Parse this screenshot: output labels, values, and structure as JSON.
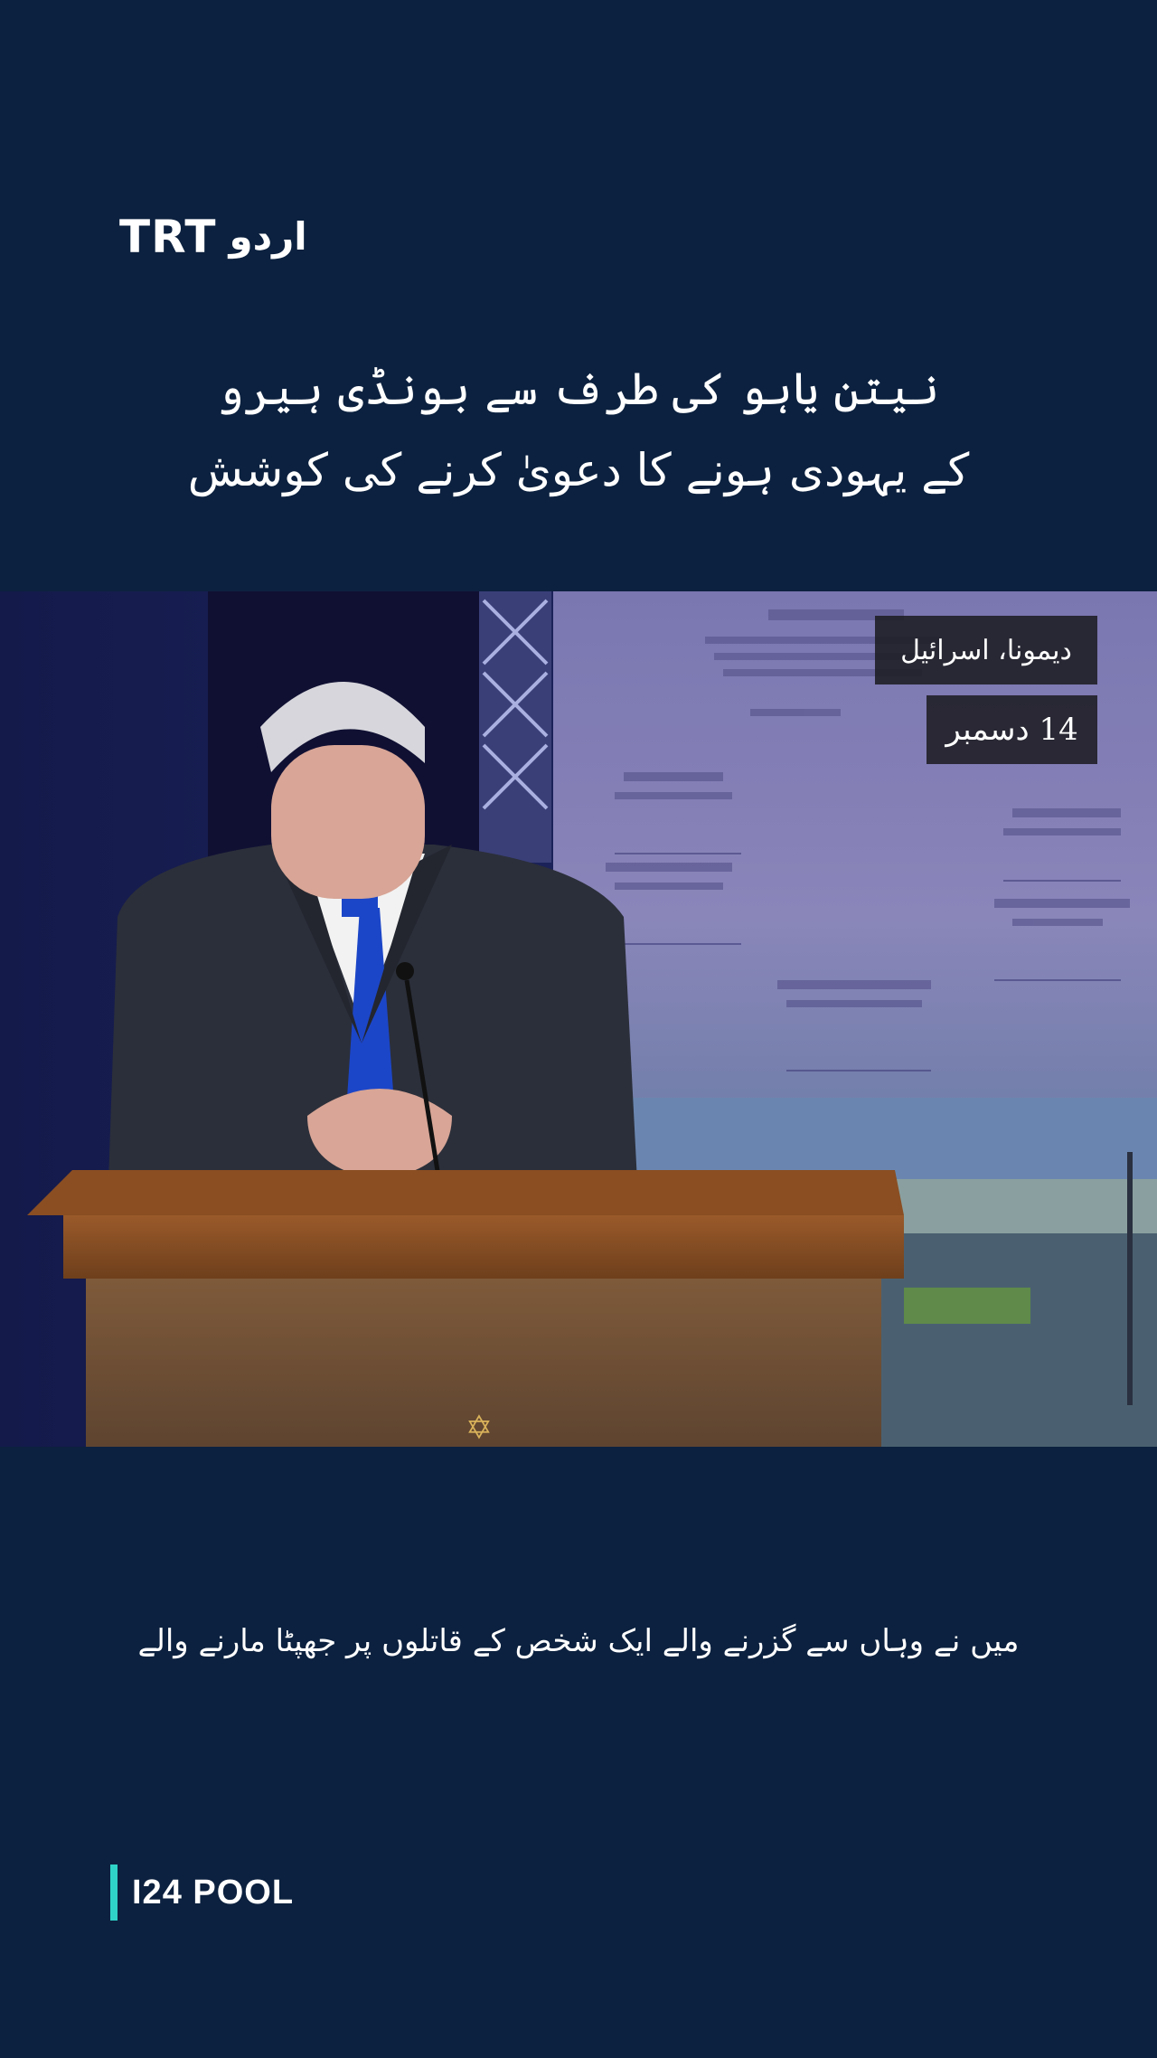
{
  "brand": {
    "latin": "TRT",
    "urdu": "اردو"
  },
  "headline": {
    "line1": "نیتن یاہو کی طرف سے بونڈی ہیرو",
    "line2": "کے یہودی ہونے کا دعویٰ کرنے کی کوشش"
  },
  "video": {
    "location": "دیمونا، اسرائیل",
    "date": "14 دسمبر",
    "podium_emblem": "menorah-emblem"
  },
  "caption": "میں نے وہاں سے گزرنے والے ایک شخص کے قاتلوں پر جھپٹا مارنے والے",
  "credit": "I24 POOL",
  "colors": {
    "background": "#0c213f",
    "accent": "#2fd3c7",
    "text": "#ffffff"
  }
}
